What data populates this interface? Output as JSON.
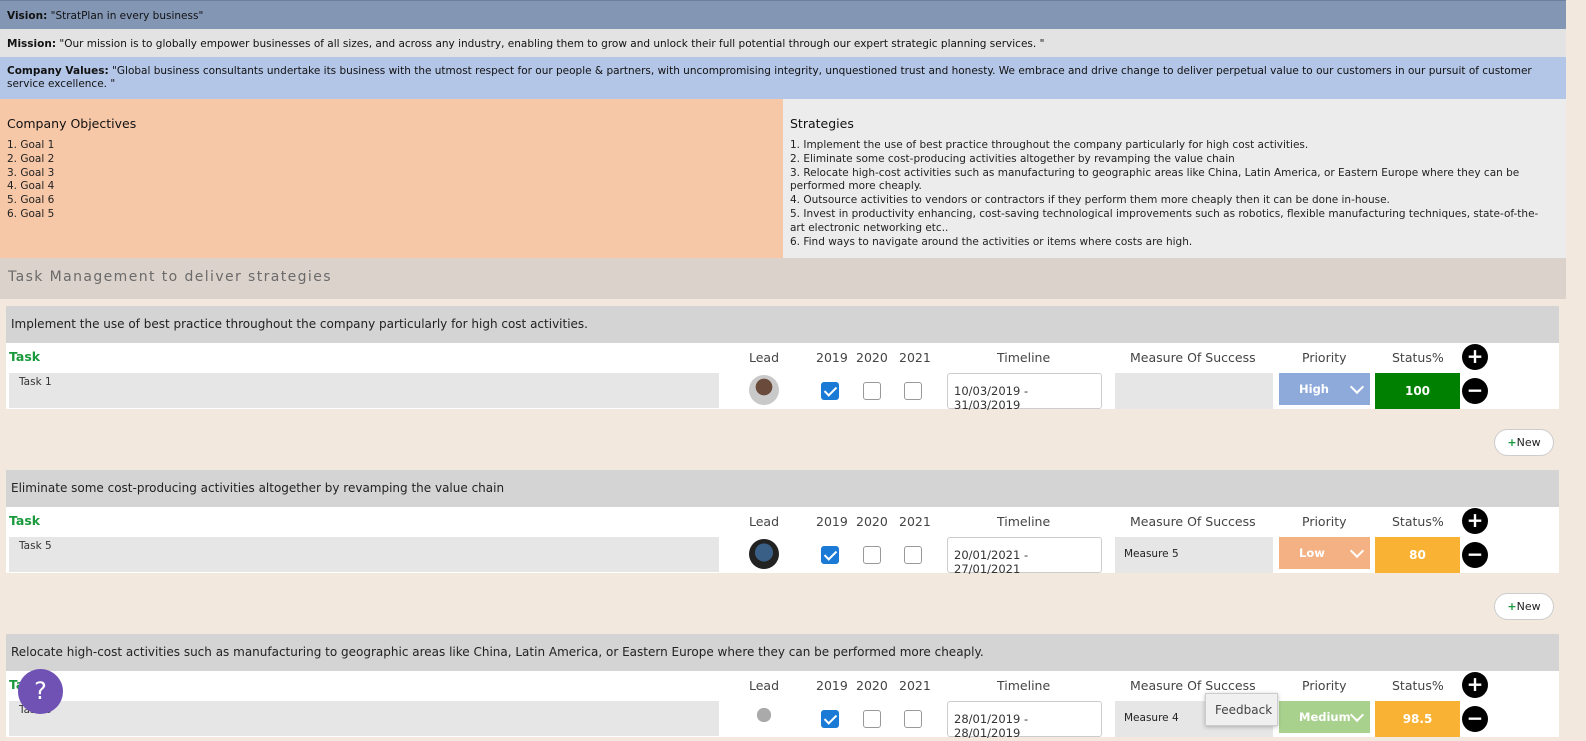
{
  "header": {
    "vision_label": "Vision:",
    "vision_text": " \"StratPlan in every business\"",
    "mission_label": "Mission:",
    "mission_text": " \"Our mission is to globally empower businesses of all sizes, and across any industry, enabling them to grow and unlock their full potential  through our expert strategic planning services.  \"",
    "values_label": "Company Values:",
    "values_text": " \"Global business consultants undertake its business with the utmost respect for our people & partners, with uncompromising integrity, unquestioned trust and honesty. We embrace and drive change to deliver perpetual value to our customers in our pursuit of customer service excellence. \""
  },
  "objectives": {
    "title": "Company Objectives",
    "items": [
      "1. Goal 1",
      "2. Goal 2",
      "3. Goal 3",
      "4. Goal 4",
      "5. Goal 6",
      "6. Goal 5"
    ]
  },
  "strategies": {
    "title": "Strategies",
    "items": [
      "1. Implement the use of best practice throughout the company particularly for high cost activities.",
      "2. Eliminate some cost-producing activities altogether by revamping the value chain",
      "3. Relocate high-cost activities such as manufacturing to geographic areas like China, Latin America, or Eastern Europe where they can be performed more cheaply.",
      "4. Outsource activities to vendors or contractors if they perform them more cheaply then it can be done in-house.",
      "5. Invest in productivity enhancing, cost-saving technological improvements such as robotics, flexible manufacturing techniques, state-of-the-art electronic networking etc..",
      "6. Find ways to navigate around the activities or items where costs are high."
    ]
  },
  "task_management": {
    "title": "Task Management to deliver strategies",
    "columns": {
      "task": "Task",
      "lead": "Lead",
      "y2019": "2019",
      "y2020": "2020",
      "y2021": "2021",
      "timeline": "Timeline",
      "measure": "Measure Of Success",
      "priority": "Priority",
      "status": "Status%"
    },
    "new_label": "New",
    "groups": [
      {
        "title": "Implement the use of best practice throughout the company particularly for high cost activities.",
        "task": "Task 1",
        "checks": [
          true,
          false,
          false
        ],
        "timeline": "10/03/2019 - 31/03/2019",
        "measure": "",
        "priority": "High",
        "priority_color": "#8eaadb",
        "status": "100",
        "status_color": "#008000"
      },
      {
        "title": "Eliminate some cost-producing activities altogether by revamping the value chain",
        "task": "Task 5",
        "checks": [
          true,
          false,
          false
        ],
        "timeline": "20/01/2021 - 27/01/2021",
        "measure": "Measure 5",
        "priority": "Low",
        "priority_color": "#f4b183",
        "status": "80",
        "status_color": "#f9b233"
      },
      {
        "title": "Relocate high-cost activities such as manufacturing to geographic areas like China, Latin America, or Eastern Europe where they can be performed more cheaply.",
        "task": "Task 6",
        "checks": [
          true,
          false,
          false
        ],
        "timeline": "28/01/2019 - 28/01/2019",
        "measure": "Measure 4",
        "priority": "Medium",
        "priority_color": "#a9d18e",
        "status": "98.5",
        "status_color": "#f9b233"
      }
    ]
  },
  "widgets": {
    "help_label": "?",
    "feedback_label": "Feedback"
  }
}
